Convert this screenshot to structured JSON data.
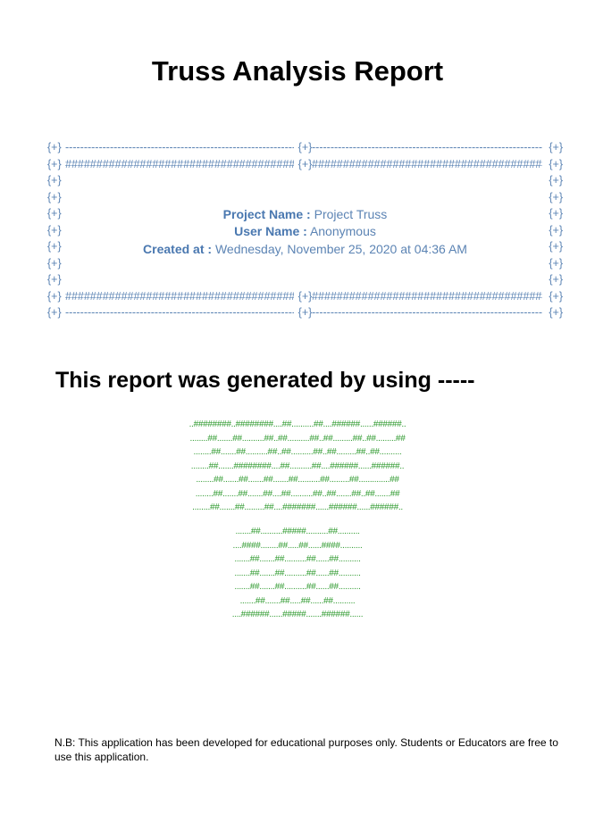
{
  "report": {
    "title": "Truss Analysis Report",
    "project_label": "Project Name :",
    "project_value": "Project Truss",
    "user_label": "User Name :",
    "user_value": "Anonymous",
    "created_label": "Created at :",
    "created_value": "Wednesday, November 25, 2020 at 04:36 AM"
  },
  "banner": {
    "corner": "{+}",
    "dash_fill": "--------------------------------------------------------------------------------------------------------",
    "hash_fill": "##################################################"
  },
  "generator": {
    "heading": "This report was generated by using -----",
    "ascii_top": [
      "..########..########....##..........##....######......######..",
      "........##.......##..........##..##..........##..##.........##..##.........##",
      "........##.......##..........##..##..........##..##.........##..##..........",
      "........##.......########....##..........##....######......######..",
      "........##.......##.......##.......##..........##.........##..............##",
      "........##.......##.......##....##..........##..##.......##..##.......##",
      "........##.......##.........##....#######......######......######.."
    ],
    "ascii_bottom": [
      ".......##..........#####..........##..........",
      "....####........##.....##......####..........",
      ".......##.......##..........##......##..........",
      ".......##.......##..........##......##..........",
      ".......##.......##..........##......##..........",
      ".......##.......##.....##......##..........",
      "....######......#####.......######......"
    ]
  },
  "note": "N.B: This application has been developed for educational purposes only. Students or Educators are free to use this application."
}
